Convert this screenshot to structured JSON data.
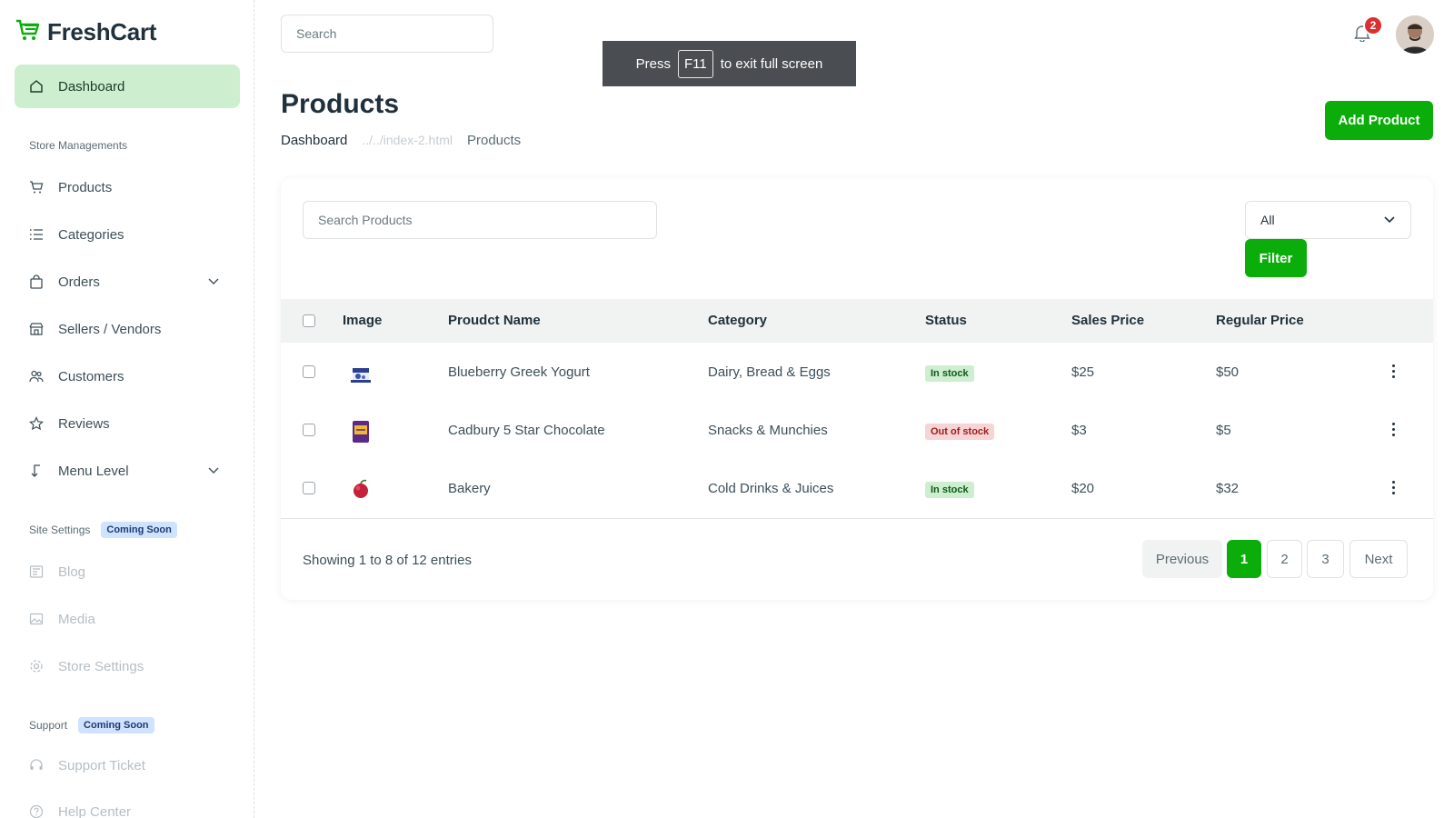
{
  "brand": {
    "name": "FreshCart"
  },
  "sidebar": {
    "dashboard": "Dashboard",
    "store_section": "Store Managements",
    "items": [
      {
        "label": "Products",
        "icon": "cart-icon"
      },
      {
        "label": "Categories",
        "icon": "list-icon"
      },
      {
        "label": "Orders",
        "icon": "bag-icon"
      },
      {
        "label": "Sellers / Vendors",
        "icon": "shop-icon"
      },
      {
        "label": "Customers",
        "icon": "people-icon"
      },
      {
        "label": "Reviews",
        "icon": "star-icon"
      },
      {
        "label": "Menu Level",
        "icon": "arrow-icon"
      }
    ],
    "site_section": "Site Settings",
    "site_badge": "Coming Soon",
    "site_items": [
      {
        "label": "Blog"
      },
      {
        "label": "Media"
      },
      {
        "label": "Store Settings"
      }
    ],
    "support_section": "Support",
    "support_badge": "Coming Soon",
    "support_items": [
      {
        "label": "Support Ticket"
      },
      {
        "label": "Help Center"
      }
    ]
  },
  "topbar": {
    "search_placeholder": "Search",
    "notification_count": "2"
  },
  "fullscreen_toast": {
    "press": "Press",
    "key": "F11",
    "suffix": "to exit full screen"
  },
  "header": {
    "title": "Products",
    "breadcrumb_home": "Dashboard",
    "breadcrumb_link": "../../index-2.html",
    "breadcrumb_current": "Products",
    "add_button": "Add Product"
  },
  "filters": {
    "search_placeholder": "Search Products",
    "status_selected": "All",
    "filter_button": "Filter"
  },
  "table": {
    "headers": [
      "Image",
      "Proudct Name",
      "Category",
      "Status",
      "Sales Price",
      "Regular Price"
    ],
    "rows": [
      {
        "name": "Blueberry Greek Yogurt",
        "category": "Dairy, Bread & Eggs",
        "status": "In stock",
        "sales_price": "$25",
        "regular_price": "$50"
      },
      {
        "name": "Cadbury 5 Star Chocolate",
        "category": "Snacks & Munchies",
        "status": "Out of stock",
        "sales_price": "$3",
        "regular_price": "$5"
      },
      {
        "name": "Bakery",
        "category": "Cold Drinks & Juices",
        "status": "In stock",
        "sales_price": "$20",
        "regular_price": "$32"
      }
    ]
  },
  "pagination": {
    "showing": "Showing 1 to 8 of 12 entries",
    "previous": "Previous",
    "pages": [
      "1",
      "2",
      "3"
    ],
    "next": "Next",
    "current": "1"
  },
  "colors": {
    "brand": "#0aad0a",
    "active_nav_bg": "#cdeecf",
    "danger": "#db3030"
  }
}
